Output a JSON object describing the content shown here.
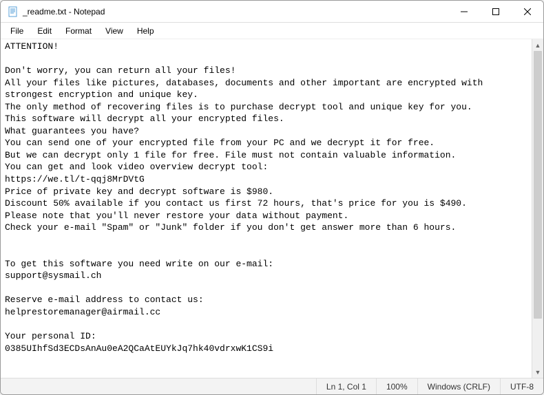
{
  "titlebar": {
    "title": "_readme.txt - Notepad"
  },
  "menubar": {
    "items": [
      "File",
      "Edit",
      "Format",
      "View",
      "Help"
    ]
  },
  "document": {
    "text": "ATTENTION!\n\nDon't worry, you can return all your files!\nAll your files like pictures, databases, documents and other important are encrypted with strongest encryption and unique key.\nThe only method of recovering files is to purchase decrypt tool and unique key for you.\nThis software will decrypt all your encrypted files.\nWhat guarantees you have?\nYou can send one of your encrypted file from your PC and we decrypt it for free.\nBut we can decrypt only 1 file for free. File must not contain valuable information.\nYou can get and look video overview decrypt tool:\nhttps://we.tl/t-qqj8MrDVtG\nPrice of private key and decrypt software is $980.\nDiscount 50% available if you contact us first 72 hours, that's price for you is $490.\nPlease note that you'll never restore your data without payment.\nCheck your e-mail \"Spam\" or \"Junk\" folder if you don't get answer more than 6 hours.\n\n\nTo get this software you need write on our e-mail:\nsupport@sysmail.ch\n\nReserve e-mail address to contact us:\nhelprestoremanager@airmail.cc\n\nYour personal ID:\n0385UIhfSd3ECDsAnAu0eA2QCaAtEUYkJq7hk40vdrxwK1CS9i"
  },
  "statusbar": {
    "position": "Ln 1, Col 1",
    "zoom": "100%",
    "line_ending": "Windows (CRLF)",
    "encoding": "UTF-8"
  }
}
